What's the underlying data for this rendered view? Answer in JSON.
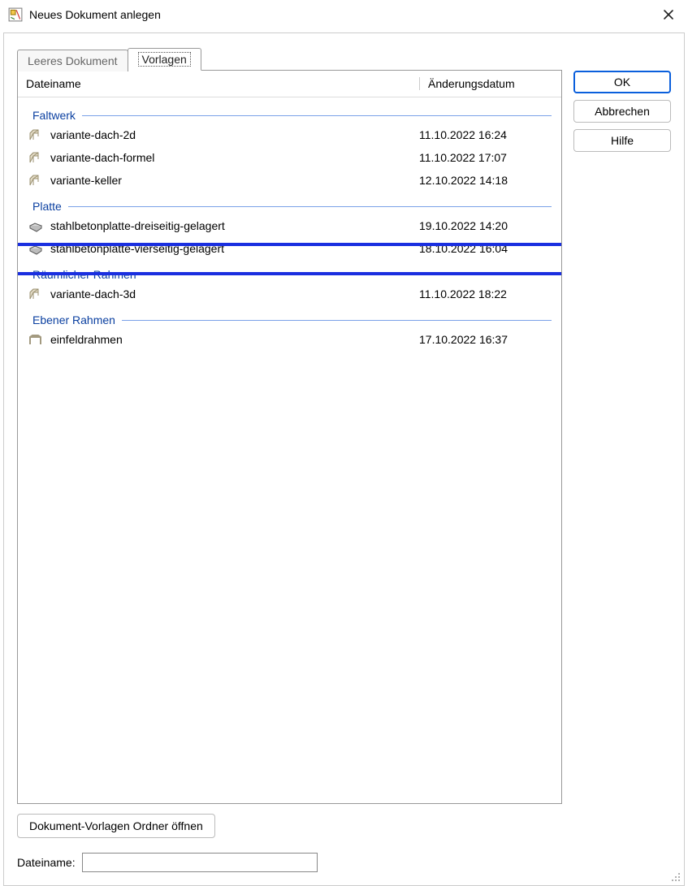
{
  "window": {
    "title": "Neues Dokument anlegen"
  },
  "tabs": {
    "leer": "Leeres Dokument",
    "vorlagen": "Vorlagen"
  },
  "columns": {
    "name": "Dateiname",
    "date": "Änderungsdatum"
  },
  "groups": [
    {
      "title": "Faltwerk",
      "icon": "faltwerk",
      "items": [
        {
          "name": "variante-dach-2d",
          "date": "11.10.2022 16:24"
        },
        {
          "name": "variante-dach-formel",
          "date": "11.10.2022 17:07"
        },
        {
          "name": "variante-keller",
          "date": "12.10.2022 14:18"
        }
      ]
    },
    {
      "title": "Platte",
      "icon": "platte",
      "items": [
        {
          "name": "stahlbetonplatte-dreiseitig-gelagert",
          "date": "19.10.2022 14:20"
        },
        {
          "name": "stahlbetonplatte-vierseitig-gelagert",
          "date": "18.10.2022 16:04"
        }
      ]
    },
    {
      "title": "Räumlicher Rahmen",
      "icon": "faltwerk",
      "items": [
        {
          "name": "variante-dach-3d",
          "date": "11.10.2022 18:22"
        }
      ]
    },
    {
      "title": "Ebener Rahmen",
      "icon": "rahmen",
      "items": [
        {
          "name": "einfeldrahmen",
          "date": "17.10.2022 16:37"
        }
      ]
    }
  ],
  "buttons": {
    "ok": "OK",
    "cancel": "Abbrechen",
    "help": "Hilfe",
    "open_folder": "Dokument-Vorlagen Ordner öffnen"
  },
  "bottom": {
    "dateiname_label": "Dateiname:",
    "dateiname_value": ""
  }
}
